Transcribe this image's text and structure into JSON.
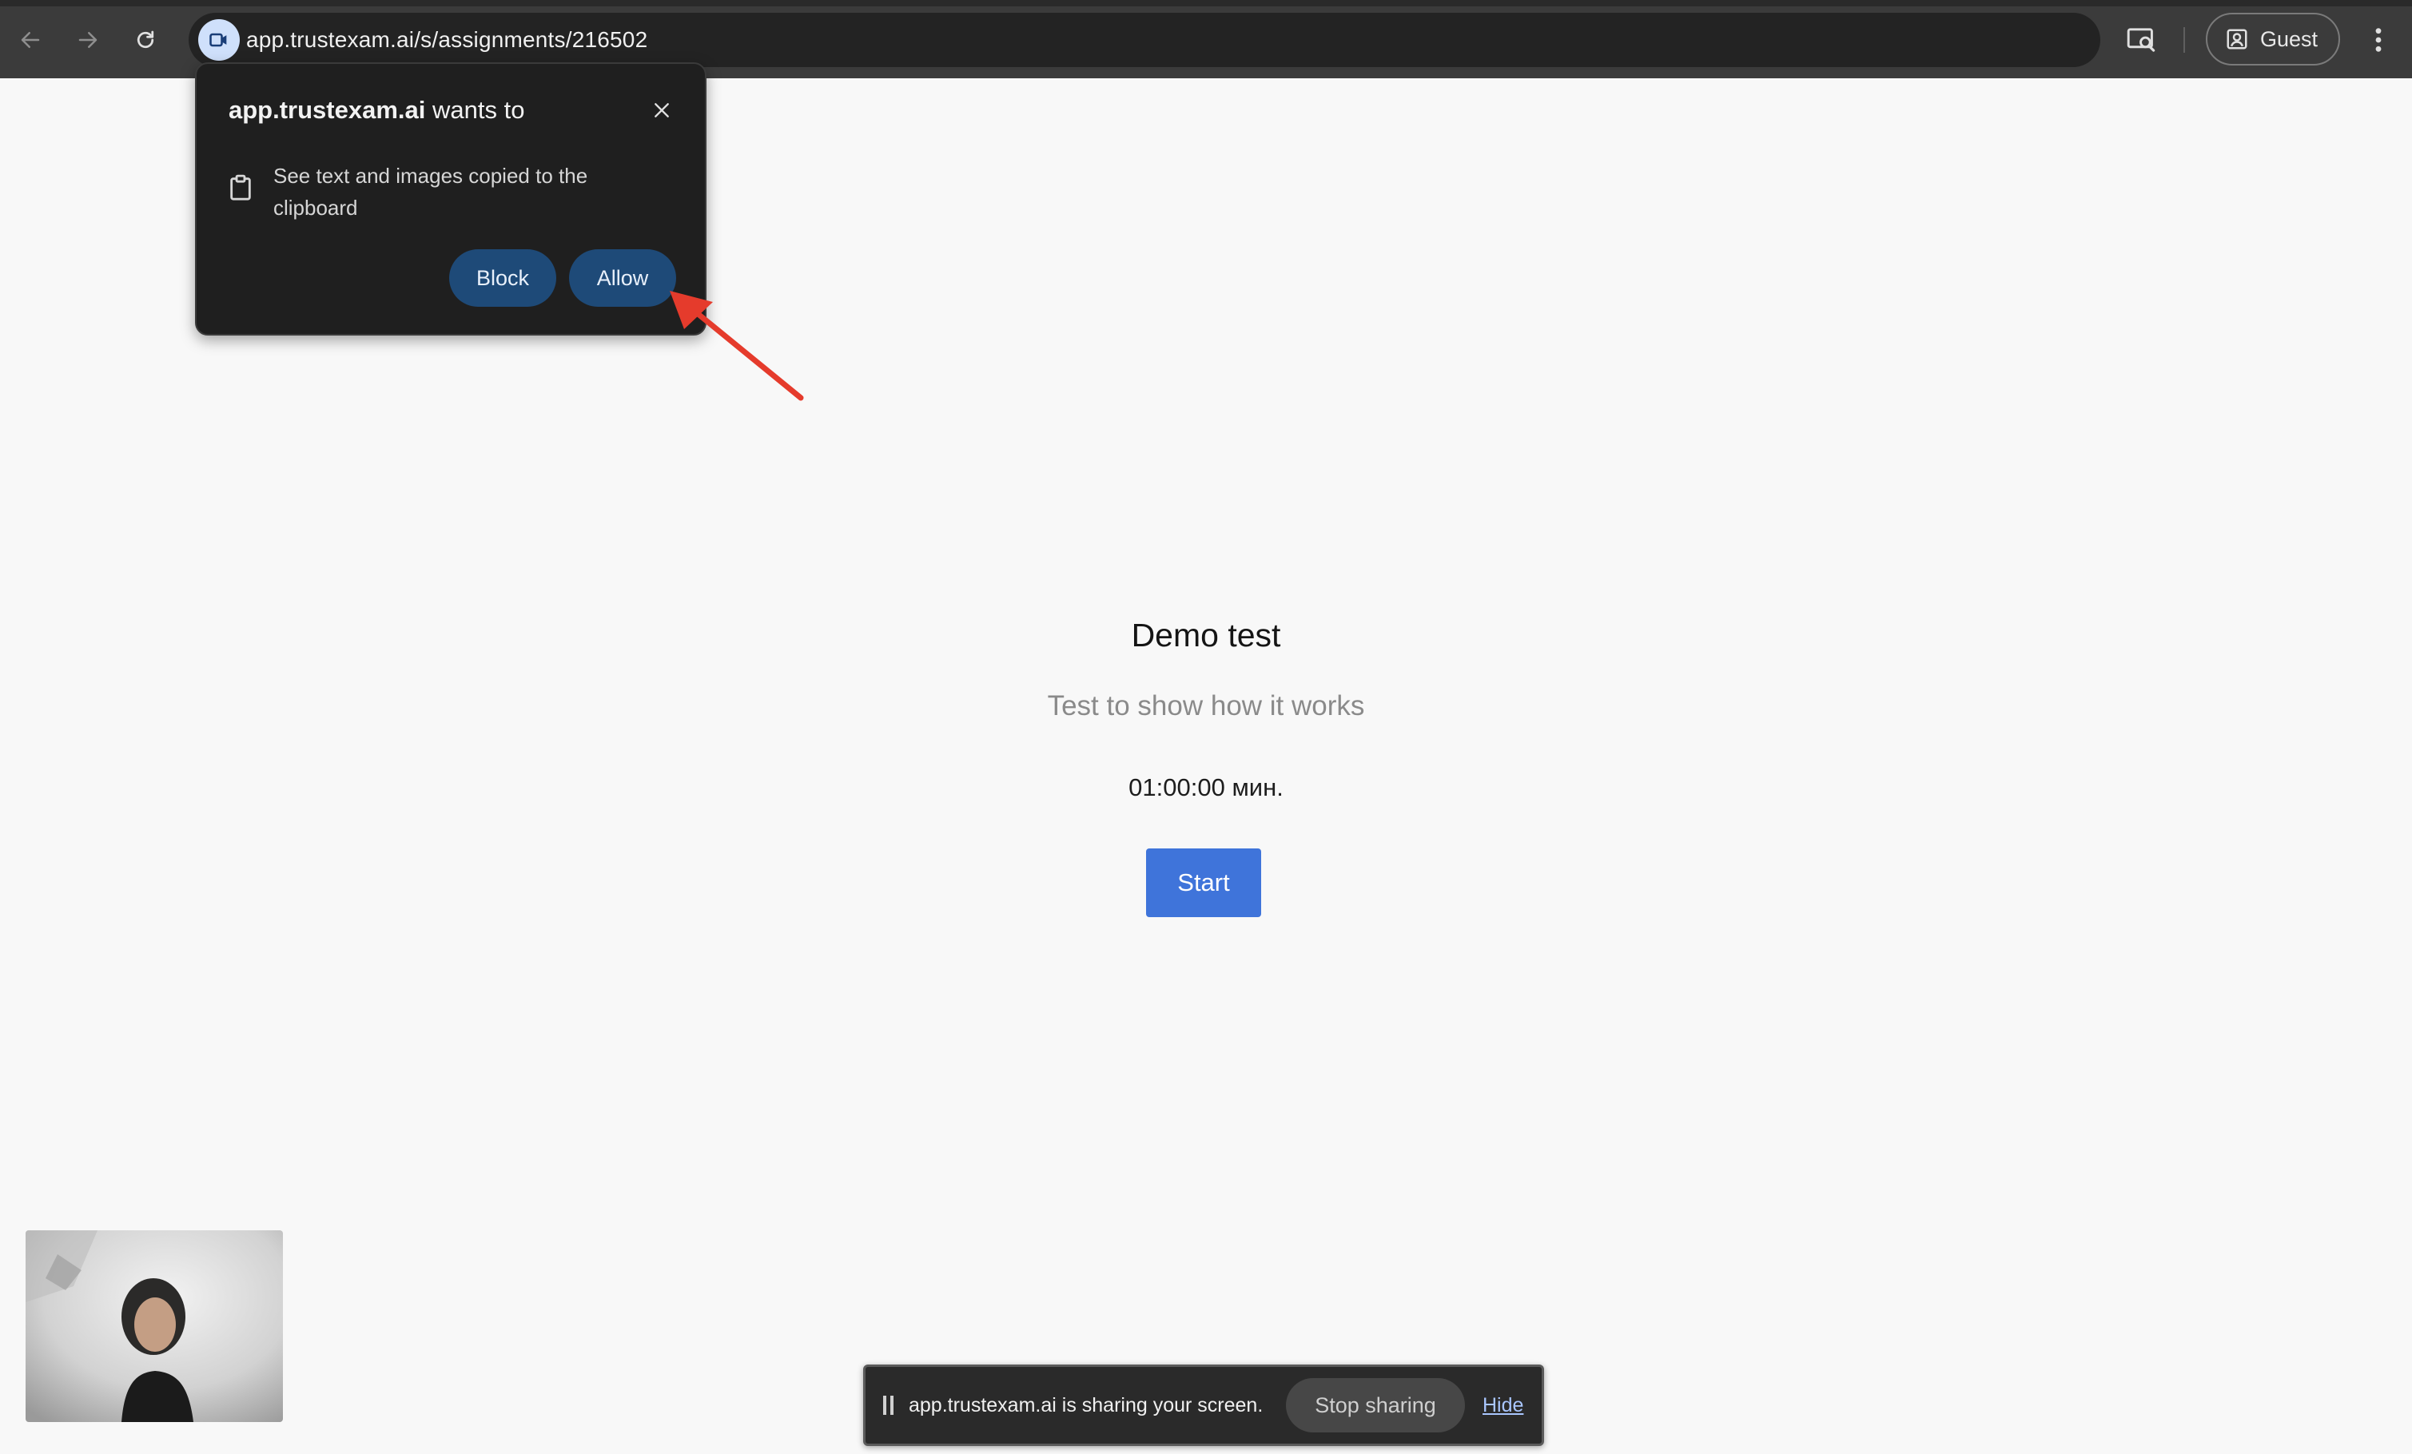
{
  "browser": {
    "url": "app.trustexam.ai/s/assignments/216502",
    "profile_label": "Guest",
    "icons": {
      "back": "arrow-left-icon",
      "forward": "arrow-right-icon",
      "reload": "reload-icon",
      "site": "camera-icon",
      "cast": "cast-search-icon",
      "profile": "person-icon",
      "menu": "kebab-menu-icon"
    }
  },
  "permission_prompt": {
    "site": "app.trustexam.ai",
    "title_suffix": "wants to",
    "description": "See text and images copied to the clipboard",
    "block_label": "Block",
    "allow_label": "Allow",
    "icons": {
      "close": "close-icon",
      "clipboard": "clipboard-icon"
    }
  },
  "test": {
    "title": "Demo test",
    "subtitle": "Test to show how it works",
    "duration": "01:00:00 мин.",
    "start_label": "Start"
  },
  "screen_share": {
    "message": "app.trustexam.ai is sharing your screen.",
    "stop_label": "Stop sharing",
    "hide_label": "Hide"
  },
  "colors": {
    "accent_blue": "#3f74da",
    "dialog_button": "#1e4a78",
    "annotation_red": "#e53b2c",
    "page_background": "#f8f8f8"
  }
}
